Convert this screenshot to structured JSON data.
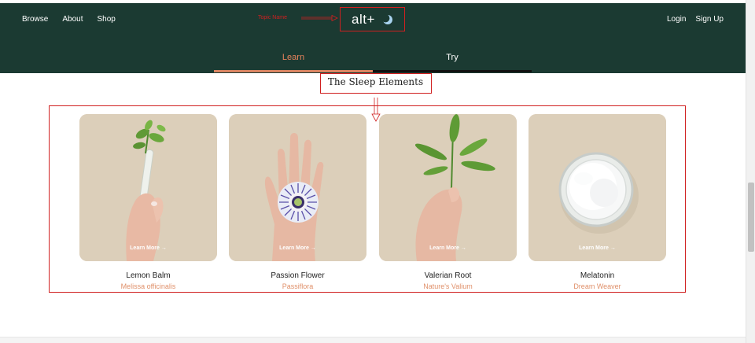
{
  "header": {
    "nav_left": [
      "Browse",
      "About",
      "Shop"
    ],
    "nav_right": [
      "Login",
      "Sign Up"
    ],
    "topic_label": "Topic Name",
    "logo_text": "alt+",
    "logo_icon": "moon-icon",
    "tabs": [
      {
        "label": "Learn",
        "active": true
      },
      {
        "label": "Try",
        "active": false
      }
    ],
    "background_color": "#1b3a32",
    "accent_color": "#e8835c"
  },
  "section": {
    "title": "The Sleep Elements"
  },
  "cards": [
    {
      "name": "Lemon Balm",
      "subtitle": "Melissa officinalis",
      "cta": "Learn More →"
    },
    {
      "name": "Passion Flower",
      "subtitle": "Passiflora",
      "cta": "Learn More →"
    },
    {
      "name": "Valerian Root",
      "subtitle": "Nature's Valium",
      "cta": "Learn More →"
    },
    {
      "name": "Melatonin",
      "subtitle": "Dream Weaver",
      "cta": "Learn More →"
    }
  ],
  "annotation_color": "#d02020"
}
